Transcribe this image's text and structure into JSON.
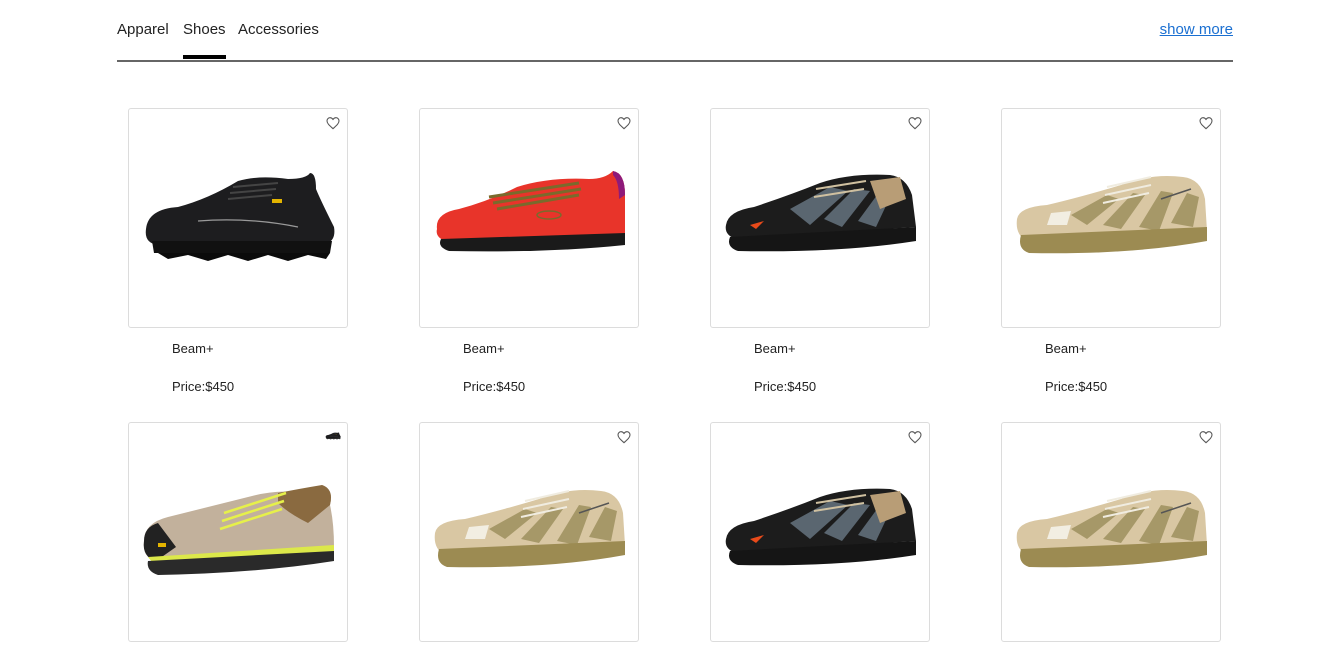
{
  "tabs": [
    {
      "label": "Apparel",
      "active": false
    },
    {
      "label": "Shoes",
      "active": true
    },
    {
      "label": "Accessories",
      "active": false
    }
  ],
  "show_more": "show more",
  "products": [
    {
      "name": "Beam+",
      "price": "Price:$450",
      "shoe": "black-trail-sneaker"
    },
    {
      "name": "Beam+",
      "price": "Price:$450",
      "shoe": "red-suede-sneaker"
    },
    {
      "name": "Beam+",
      "price": "Price:$450",
      "shoe": "black-grey-runner"
    },
    {
      "name": "Beam+",
      "price": "Price:$450",
      "shoe": "beige-olive-trail-runner"
    },
    {
      "shoe": "tan-hiking-shoe"
    },
    {
      "shoe": "beige-olive-trail-runner"
    },
    {
      "shoe": "black-grey-runner"
    },
    {
      "shoe": "beige-olive-trail-runner"
    }
  ],
  "colors": {
    "accent_link": "#1a6fd1",
    "active_tab_underline": "#000000",
    "card_border": "#dcdcdc"
  }
}
